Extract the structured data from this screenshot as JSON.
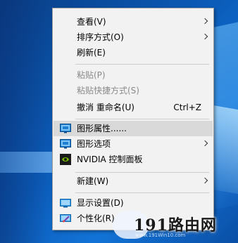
{
  "menu": {
    "items": [
      {
        "label": "查看(V)",
        "submenu": true
      },
      {
        "label": "排序方式(O)",
        "submenu": true
      },
      {
        "label": "刷新(E)"
      },
      {
        "label": "粘贴(P)",
        "disabled": true
      },
      {
        "label": "粘贴快捷方式(S)",
        "disabled": true
      },
      {
        "label": "撤消 重命名(U)",
        "shortcut": "Ctrl+Z"
      },
      {
        "label": "图形属性......",
        "icon": "intel-graphics-icon",
        "highlighted": true
      },
      {
        "label": "图形选项",
        "icon": "intel-graphics-icon",
        "submenu": true
      },
      {
        "label": "NVIDIA 控制面板",
        "icon": "nvidia-icon"
      },
      {
        "label": "新建(W)",
        "submenu": true
      },
      {
        "label": "显示设置(D)",
        "icon": "display-settings-icon"
      },
      {
        "label": "个性化(R)",
        "icon": "personalize-icon"
      }
    ]
  },
  "watermark": {
    "brand": "191路由网",
    "sub": "www.191Win10.com"
  },
  "colors": {
    "menu_bg": "#f2f2f2",
    "highlight": "#d9d9d9",
    "disabled_text": "#8a8a8a",
    "intel_blue": "#0f6fc1",
    "nvidia_green": "#76b900"
  }
}
